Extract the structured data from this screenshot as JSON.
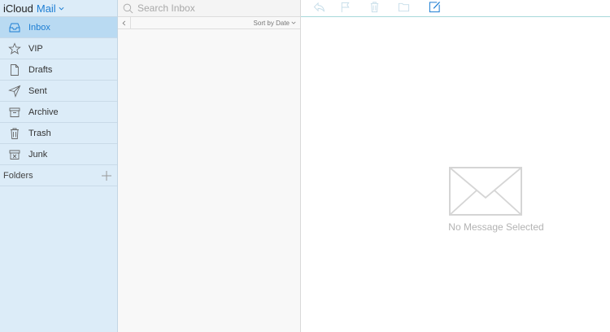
{
  "brand": {
    "name": "iCloud",
    "app": "Mail"
  },
  "sidebar": {
    "items": [
      {
        "label": "Inbox",
        "icon": "inbox-icon",
        "active": true
      },
      {
        "label": "VIP",
        "icon": "star-icon",
        "active": false
      },
      {
        "label": "Drafts",
        "icon": "document-icon",
        "active": false
      },
      {
        "label": "Sent",
        "icon": "paper-plane-icon",
        "active": false
      },
      {
        "label": "Archive",
        "icon": "archive-box-icon",
        "active": false
      },
      {
        "label": "Trash",
        "icon": "trash-icon",
        "active": false
      },
      {
        "label": "Junk",
        "icon": "junk-box-icon",
        "active": false
      }
    ],
    "folders_label": "Folders"
  },
  "list": {
    "search_placeholder": "Search Inbox",
    "sort_label": "Sort by Date"
  },
  "reader": {
    "empty_text": "No Message Selected",
    "toolbar_icons": [
      "reply-icon",
      "flag-icon",
      "trash-icon",
      "folder-icon",
      "compose-icon"
    ]
  },
  "colors": {
    "accent": "#1d7ed3",
    "sidebar_bg": "#dcecf8",
    "sidebar_active_bg": "#b9daf2",
    "toolbar_icon_disabled": "#c6dde9"
  }
}
